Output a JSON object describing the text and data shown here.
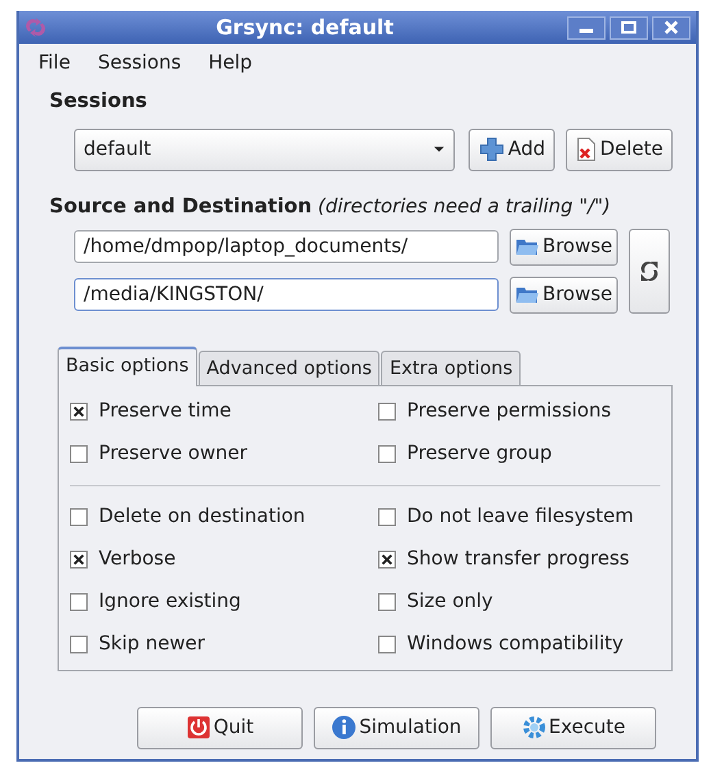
{
  "window": {
    "title": "Grsync: default"
  },
  "menu": [
    "File",
    "Sessions",
    "Help"
  ],
  "sessions": {
    "heading": "Sessions",
    "selected_session": "default",
    "add_button": "Add",
    "delete_button": "Delete"
  },
  "source_destination": {
    "heading": "Source and Destination",
    "hint": "(directories need a trailing \"/\")",
    "source": "/home/dmpop/laptop_documents/",
    "destination": "/media/KINGSTON/",
    "browse_buttons": [
      "Browse",
      "Browse"
    ]
  },
  "tabs": [
    {
      "label": "Basic options",
      "selected": true
    },
    {
      "label": "Advanced options",
      "selected": false
    },
    {
      "label": "Extra options",
      "selected": false
    }
  ],
  "option_groups": [
    {
      "options": [
        {
          "label": "Preserve time",
          "checked": true
        },
        {
          "label": "Preserve permissions",
          "checked": false
        },
        {
          "label": "Preserve owner",
          "checked": false
        },
        {
          "label": "Preserve group",
          "checked": false
        }
      ]
    },
    {
      "options": [
        {
          "label": "Delete on destination",
          "checked": false
        },
        {
          "label": "Do not leave filesystem",
          "checked": false
        },
        {
          "label": "Verbose",
          "checked": true
        },
        {
          "label": "Show transfer progress",
          "checked": true
        },
        {
          "label": "Ignore existing",
          "checked": false
        },
        {
          "label": "Size only",
          "checked": false
        },
        {
          "label": "Skip newer",
          "checked": false
        },
        {
          "label": "Windows compatibility",
          "checked": false
        }
      ]
    }
  ],
  "buttons": [
    {
      "kind": "quit",
      "label": "Quit"
    },
    {
      "kind": "info",
      "label": "Simulation"
    },
    {
      "kind": "execute",
      "label": "Execute"
    }
  ]
}
